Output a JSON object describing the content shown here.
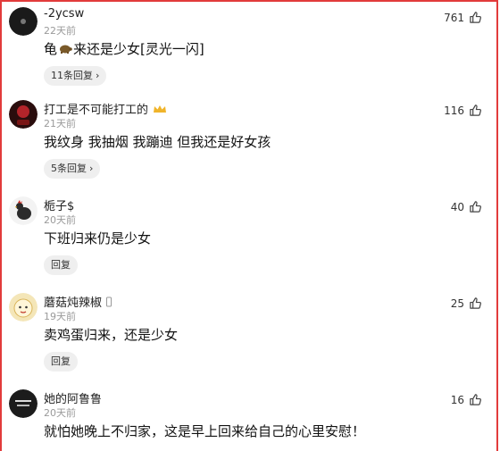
{
  "comments": [
    {
      "username": "-2ycsw",
      "time": "22天前",
      "text_a": "龟",
      "text_b": "来还是少女[灵光一闪]",
      "reply_label": "11条回复",
      "likes": "761",
      "avatar_icon": "dark-logo-avatar"
    },
    {
      "username": "打工是不可能打工的",
      "time": "21天前",
      "text": "我纹身 我抽烟 我蹦迪 但我还是好女孩",
      "reply_label": "5条回复",
      "likes": "116",
      "avatar_icon": "red-black-avatar"
    },
    {
      "username": "栀子$",
      "time": "20天前",
      "text": "下班归来仍是少女",
      "reply_label": "回复",
      "likes": "40",
      "avatar_icon": "rooster-avatar"
    },
    {
      "username": "蘑菇炖辣椒",
      "time": "19天前",
      "text": "卖鸡蛋归来，还是少女",
      "reply_label": "回复",
      "likes": "25",
      "avatar_icon": "cartoon-face-avatar"
    },
    {
      "username": "她的阿鲁鲁",
      "time": "20天前",
      "text": "就怕她晚上不归家，这是早上回来给自己的心里安慰！",
      "reply_label": "",
      "likes": "16",
      "avatar_icon": "dark-text-avatar"
    }
  ],
  "colors": {
    "border": "#e23b3b",
    "time": "#9a9a9a",
    "chip_bg": "#efefef"
  }
}
